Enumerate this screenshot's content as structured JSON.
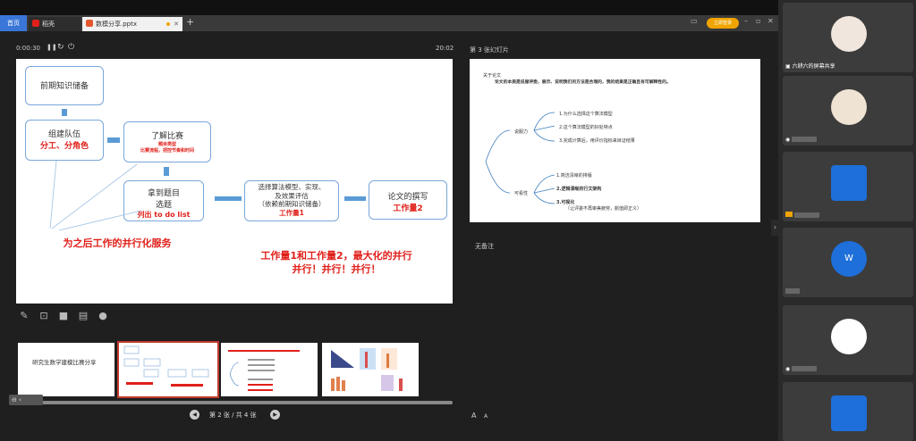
{
  "tabs": {
    "home": "首页",
    "inactive": "稻壳",
    "active": "数模分享.pptx"
  },
  "login_label": "立即登录",
  "player": {
    "elapsed": "0:00:30",
    "remaining": "20:02"
  },
  "slide": {
    "box_prep": "前期知识储备",
    "box_team": "组建队伍",
    "box_team_red": "分工、分角色",
    "box_learn": "了解比赛",
    "box_learn_red1": "题目类型",
    "box_learn_red2": "比赛流程，把控节奏和时间",
    "box_topic1": "拿到题目",
    "box_topic2": "选题",
    "box_topic_red": "列出 to do list",
    "box_algo1": "选择算法模型、实现、",
    "box_algo2": "及效果评估",
    "box_algo3": "（依赖前期知识储备）",
    "box_algo_red": "工作量1",
    "box_paper": "论文的撰写",
    "box_paper_red": "工作量2",
    "note_left": "为之后工作的并行化服务",
    "note_right1": "工作量1和工作量2，最大化的并行",
    "note_right2": "并行！并行！并行！"
  },
  "right_slide": {
    "label": "第 3 张幻灯片",
    "title": "关于论文",
    "subtitle": "论文的本质是说服评委，展示、说明我们的方法是合理的，我的结果是正确且有可解释性的。",
    "branch_a": "说服力",
    "a1": "1.为什么选择这个算法模型",
    "a2": "2.这个算法模型的好处特点",
    "a3": "3.完成计算后，用评价指标来目证结果",
    "branch_b": "可看性",
    "b1": "1.简洁清晰的排版",
    "b2": "2.逻辑清晰的行文架构",
    "b3": "3.可视化",
    "b3note": "（让评委不再审美疲劳，颜值即正义）",
    "notes": "无备注"
  },
  "thumbs": {
    "t1": "研究生数学建模比赛分享"
  },
  "pager": {
    "text": "第 2 张 / 共 4 张"
  },
  "participants": {
    "screen_share": "六耕六的屏幕共享",
    "w_initial": "W"
  },
  "icons": [
    "pen-icon",
    "screenshot-icon",
    "camera-icon",
    "comment-icon",
    "more-icon",
    "prev-icon",
    "next-icon"
  ]
}
